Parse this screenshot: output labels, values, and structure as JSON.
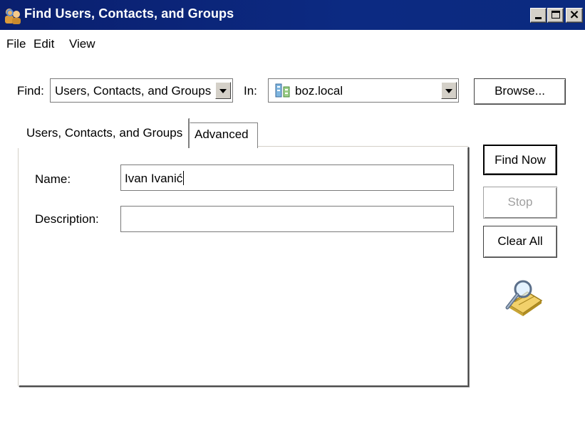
{
  "window": {
    "title": "Find Users, Contacts, and Groups",
    "icon": "find-people-icon",
    "controls": {
      "minimize": "minimize-icon",
      "maximize": "maximize-icon",
      "close": "close-icon"
    }
  },
  "menu": {
    "items": [
      "File",
      "Edit",
      "View"
    ]
  },
  "find_row": {
    "find_label": "Find:",
    "find_value": "Users, Contacts, and Groups",
    "in_label": "In:",
    "in_value": "boz.local",
    "in_icon": "domain-icon",
    "browse_label": "Browse..."
  },
  "tabs": [
    {
      "label": "Users, Contacts, and Groups",
      "active": true
    },
    {
      "label": "Advanced",
      "active": false
    }
  ],
  "form": {
    "name_label": "Name:",
    "name_value": "Ivan Ivanić",
    "description_label": "Description:",
    "description_value": ""
  },
  "actions": {
    "find_now": "Find Now",
    "stop": "Stop",
    "clear_all": "Clear All",
    "stop_enabled": false
  },
  "decor": {
    "search_icon": "magnifier-search-icon"
  },
  "colors": {
    "titlebar": "#0a246a",
    "title_text": "#ffffff",
    "disabled_text": "#a0a0a0"
  }
}
